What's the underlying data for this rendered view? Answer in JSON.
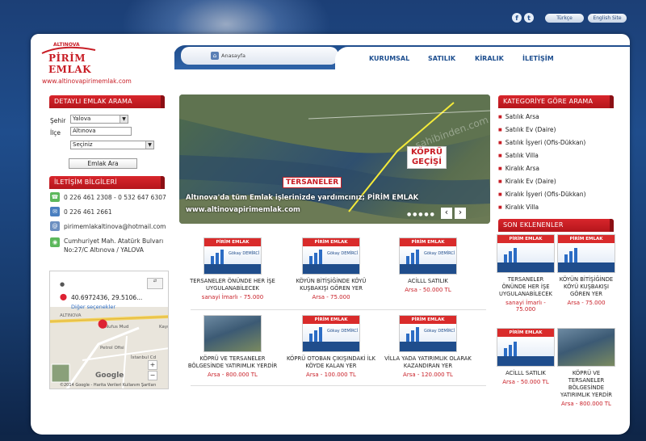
{
  "header": {
    "lang_tr": "Türkçe",
    "lang_en": "English Site",
    "logo_top": "ALTINOVA",
    "logo_main": "PİRİM EMLAK",
    "url": "www.altinovapirimemlak.com",
    "home_label": "Anasayfa"
  },
  "nav": {
    "items": [
      "KURUMSAL",
      "SATILIK",
      "KİRALIK",
      "İLETİŞİM"
    ]
  },
  "search": {
    "title": "DETAYLI EMLAK ARAMA",
    "city_label": "Şehir",
    "city_value": "Yalova",
    "district_label": "İlçe",
    "district_value": "Altınova",
    "type_value": "Seçiniz",
    "button": "Emlak Ara"
  },
  "contact": {
    "title": "İLETİŞİM BİLGİLERİ",
    "phone": "0 226 461 2308 - 0 532 647 6307",
    "fax": "0 226 461 2661",
    "email": "pirimemlakaltinova@hotmail.com",
    "address_1": "Cumhuriyet Mah. Atatürk Bulvarı",
    "address_2": "No:27/C Altınova / YALOVA"
  },
  "map": {
    "coords": "40.6972436, 29.5106...",
    "more": "Diğer seçenekler",
    "label_1": "ALTINOVA",
    "label_2": "Nufus Mud",
    "label_3": "Petrol Ofisi",
    "label_4": "İstanbul Cd",
    "label_5": "Kayı",
    "brand": "Google",
    "footer": "©2014 Google - Harita Verileri   Kullanım Şartları"
  },
  "slider": {
    "badge_1": "KÖPRÜ",
    "badge_2": "GEÇİŞİ",
    "tag": "TERSANELER",
    "caption_1": "Altınova'da tüm Emlak işlerinizde yardımcınız; PİRİM EMLAK",
    "caption_2": "www.altinovapirimemlak.com",
    "watermark": "sahibinden.com",
    "prev": "‹",
    "next": "›"
  },
  "products": [
    {
      "title": "TERSANELER ÖNÜNDE HER İŞE UYGULANABİLECEK",
      "price": "sanayi İmarlı - 75.000"
    },
    {
      "title": "KÖYÜN BİTİŞİĞİNDE KÖYÜ KUŞBAKIŞI GÖREN YER",
      "price": "Arsa - 75.000"
    },
    {
      "title": "ACİLLL SATILIK",
      "price": "Arsa - 50.000 TL"
    },
    {
      "title": "KÖPRÜ VE TERSANELER BÖLGESİNDE YATIRIMLIK YERDİR",
      "price": "Arsa - 800.000 TL"
    },
    {
      "title": "KÖPRÜ OTOBAN ÇIKIŞINDAKİ İLK KÖYDE KALAN YER",
      "price": "Arsa - 100.000 TL"
    },
    {
      "title": "VİLLA YADA YATIRIMLIK OLARAK KAZANDIRAN YER",
      "price": "Arsa - 120.000 TL"
    }
  ],
  "categories": {
    "title": "KATEGORİYE GÖRE ARAMA",
    "items": [
      "Satılık Arsa",
      "Satılık Ev (Daire)",
      "Satılık İşyeri (Ofis-Dükkan)",
      "Satılık Villa",
      "Kiralık Arsa",
      "Kiralık Ev (Daire)",
      "Kiralık İşyeri (Ofis-Dükkan)",
      "Kiralık Villa"
    ]
  },
  "recent": {
    "title": "SON EKLENENLER",
    "items": [
      {
        "title": "TERSANELER ÖNÜNDE HER İŞE UYGULANABİLECEK",
        "price": "sanayi İmarlı - 75.000"
      },
      {
        "title": "KÖYÜN BİTİŞİĞİNDE KÖYÜ KUŞBAKIŞI GÖREN YER",
        "price": "Arsa - 75.000"
      },
      {
        "title": "ACİLLL SATILIK",
        "price": "Arsa - 50.000 TL"
      },
      {
        "title": "KÖPRÜ VE TERSANELER BÖLGESİNDE YATIRIMLIK YERDİR",
        "price": "Arsa - 800.000 TL"
      }
    ]
  },
  "thumb": {
    "brand_small": "ALTINOVA",
    "brand": "PİRİM EMLAK",
    "person": "Gökay DEMİRCİ"
  },
  "colors": {
    "accent_red": "#c81d25",
    "nav_blue": "#1d4e8f",
    "bg_blue": "#1f4d8c"
  }
}
